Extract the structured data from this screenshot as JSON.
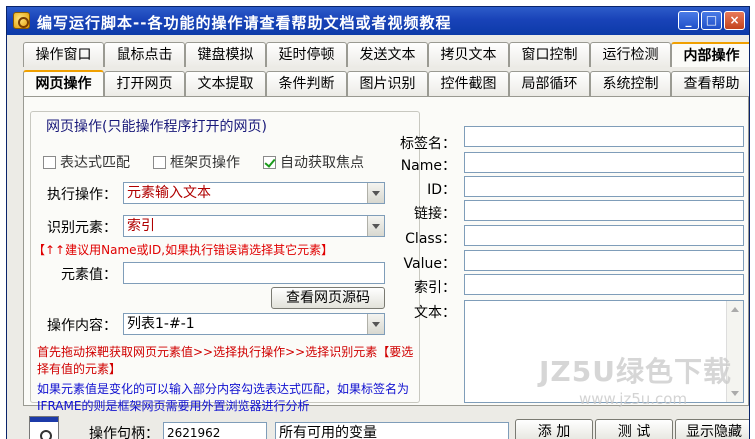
{
  "window": {
    "title": "编写运行脚本--各功能的操作请查看帮助文档或者视频教程"
  },
  "tabs_row1": [
    "操作窗口",
    "鼠标点击",
    "键盘模拟",
    "延时停顿",
    "发送文本",
    "拷贝文本",
    "窗口控制",
    "运行检测",
    "内部操作"
  ],
  "tabs_row2": [
    "网页操作",
    "打开网页",
    "文本提取",
    "条件判断",
    "图片识别",
    "控件截图",
    "局部循环",
    "系统控制",
    "查看帮助"
  ],
  "active_tab_row1": "内部操作",
  "active_tab_row2": "网页操作",
  "group": {
    "title": "网页操作(只能操作程序打开的网页)"
  },
  "checkboxes": [
    {
      "label": "表达式匹配",
      "checked": false
    },
    {
      "label": "框架页操作",
      "checked": false
    },
    {
      "label": "自动获取焦点",
      "checked": true
    }
  ],
  "exec_op": {
    "label": "执行操作：",
    "value": "元素输入文本"
  },
  "identify": {
    "label": "识别元素：",
    "value": "索引"
  },
  "hint_red": "【↑↑建议用Name或ID,如果执行错误请选择其它元素】",
  "element_value": {
    "label": "元素值：",
    "value": ""
  },
  "view_source_button": "查看网页源码",
  "op_content": {
    "label": "操作内容：",
    "value": "列表1-#-1"
  },
  "instruction_red": "首先拖动探靶获取网页元素值>>选择执行操作>>选择识别元素【要选择有值的元素】",
  "instruction_blue": "如果元素值是变化的可以输入部分内容勾选表达式匹配，如果标签名为IFRAME的则是框架网页需要用外置浏览器进行分析",
  "right_fields": [
    {
      "label": "标签名：",
      "value": ""
    },
    {
      "label": "Name：",
      "value": ""
    },
    {
      "label": "ID：",
      "value": ""
    },
    {
      "label": "链接：",
      "value": ""
    },
    {
      "label": "Class：",
      "value": ""
    },
    {
      "label": "Value：",
      "value": ""
    },
    {
      "label": "索引：",
      "value": ""
    },
    {
      "label": "文本：",
      "value": ""
    }
  ],
  "watermark": {
    "line1": "JZ5U绿色下载",
    "line2": "www.jz5u.com"
  },
  "bottom": {
    "handle_label": "操作句柄：",
    "handle_value": "2621962",
    "variables_value": "所有可用的变量",
    "add_button": "添 加",
    "test_button": "测 试",
    "toggle_button": "显示隐藏"
  }
}
